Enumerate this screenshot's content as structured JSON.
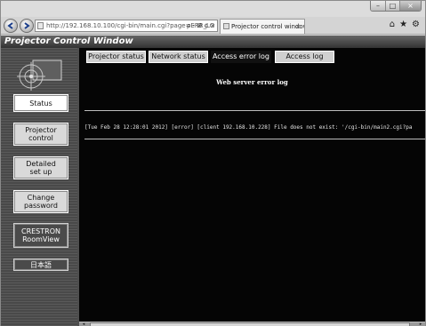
{
  "browser": {
    "address": "http://192.168.10.100/cgi-bin/main.cgi?page=ERR_LO",
    "address_tools": "ρ - ⊠ ¢ ×",
    "tab_title": "Projector control window",
    "tab_close": "×",
    "window_buttons": [
      "–",
      "□",
      "×"
    ],
    "toolbar_icons": [
      "⌂",
      "★",
      "⚙"
    ]
  },
  "app": {
    "title": "Projector Control Window"
  },
  "sidebar": {
    "items": [
      {
        "label": "Status"
      },
      {
        "label_lines": [
          "Projector",
          "control"
        ]
      },
      {
        "label_lines": [
          "Detailed",
          "set up"
        ]
      },
      {
        "label_lines": [
          "Change",
          "password"
        ]
      },
      {
        "label_lines": [
          "CRESTRON",
          "RoomView"
        ]
      },
      {
        "label": "日本語"
      }
    ]
  },
  "tabs": [
    "Projector status",
    "Network status",
    "Access error log",
    "Access log"
  ],
  "content": {
    "heading": "Web server error log",
    "log_line": "[Tue Feb 28 12:28:01 2012] [error] [client 192.168.10.228] File does not exist: '/cgi-bin/main2.cgi?pa"
  },
  "colors": {
    "sidebar_bg": "#4a4a4a",
    "content_bg": "#050505",
    "active_tab": "#111111",
    "tab_bg": "#d0d0d0"
  }
}
